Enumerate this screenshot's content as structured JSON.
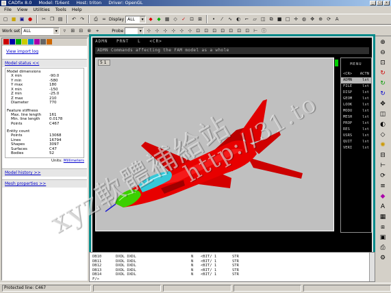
{
  "window": {
    "title_parts": [
      "CADfix 8.0",
      "Model: f16ent",
      "Host: triton",
      "Driver: OpenGL"
    ],
    "minimize": "_",
    "maximize": "□",
    "close": "x"
  },
  "menubar": [
    "File",
    "View",
    "Utilities",
    "Tools",
    "Help"
  ],
  "toolbar1": {
    "display_label": "Display",
    "display_value": "ALL"
  },
  "toolbar2": {
    "workset_label": "Work set",
    "workset_value": "ALL",
    "probe_label": "Probe"
  },
  "left": {
    "link_import": "View import log",
    "model_status": "Model status <<",
    "sections": [
      {
        "title": "Model dimensions",
        "rows": [
          [
            "X min",
            "-90.0"
          ],
          [
            "Y min",
            "-580"
          ],
          [
            "Y max",
            "180"
          ],
          [
            "X min",
            "-150"
          ],
          [
            "Z min",
            "-25.0"
          ],
          [
            "Z max",
            "210"
          ],
          [
            "Diameter",
            "770"
          ]
        ]
      },
      {
        "title": "Feature stiffness",
        "rows": [
          [
            "Max. line length",
            "161"
          ],
          [
            "Min. line length",
            "0.0178"
          ],
          [
            "Points",
            "C467"
          ]
        ]
      },
      {
        "title": "Entity count",
        "rows": [
          [
            "Points",
            "13068"
          ],
          [
            "Lines",
            "16794"
          ],
          [
            "Shapes",
            "3097"
          ],
          [
            "Surfaces",
            "C47"
          ],
          [
            "Bodies",
            "52"
          ]
        ]
      }
    ],
    "units_label": "Units:",
    "units_value": "Millimeters",
    "model_history": "Model history >>",
    "mesh_properties": "Mesh properties >>"
  },
  "main": {
    "header_items": [
      "ADMN",
      "PRNT",
      "L",
      "<CR>"
    ],
    "command_line": "ADMN  Commands affecting the FAM model as a whole",
    "viewport_badge": "5 1",
    "menu_title": "MENU",
    "menu_cols": [
      "<CR>",
      "ACTN"
    ],
    "menu_rows": [
      [
        "ADMN",
        "lst"
      ],
      [
        "FILE",
        "lst"
      ],
      [
        "DISP",
        "lst"
      ],
      [
        "GEOM",
        "lst"
      ],
      [
        "LOOK",
        "lst"
      ],
      [
        "MODU",
        "lst"
      ],
      [
        "MESH",
        "lst"
      ],
      [
        "PROP",
        "lst"
      ],
      [
        "RES",
        "lst"
      ],
      [
        "USRS",
        "lst"
      ],
      [
        "QUIT",
        "lst"
      ],
      [
        "VERI",
        "lst"
      ]
    ],
    "active_menu_index": 0
  },
  "bottom": {
    "rows": [
      [
        "DB10",
        "DXDL DXDL",
        "N",
        "<BIT/ 1",
        "STR"
      ],
      [
        "DB11",
        "DXDL DXDL",
        "N",
        "<BIT/ 1",
        "STR"
      ],
      [
        "DB12",
        "DXDL DXDL",
        "N",
        "<BIT/ 1",
        "STR"
      ],
      [
        "DB13",
        "DXDL DXDL",
        "N",
        "<BIT/ 1",
        "STR"
      ],
      [
        "DB14",
        "DXDL DXDL",
        "N",
        "<BIT/ 1",
        "STR"
      ],
      [
        "F/>",
        "",
        "",
        "",
        ""
      ]
    ]
  },
  "status": {
    "message": "Protected line: C467"
  },
  "colors": {
    "aircraft": "#e00000",
    "canopy": "#36c8d8",
    "nose": "#3cd000",
    "viewport": "#c0c0c0",
    "frame": "#008a8a"
  },
  "watermark": {
    "line1": "xyz軟體補給站",
    "line2": "http://31.to"
  }
}
